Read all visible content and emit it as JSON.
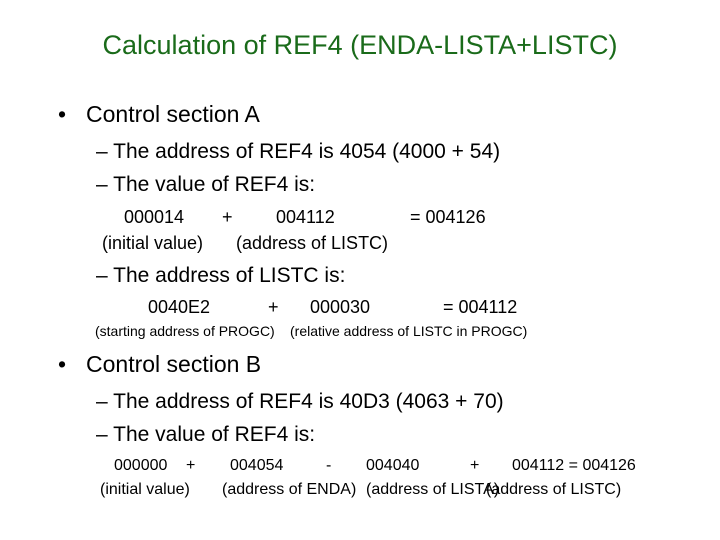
{
  "title": "Calculation of REF4 (ENDA-LISTA+LISTC)",
  "colors": {
    "title": "#1a6b1a",
    "text": "#000000",
    "background": "#ffffff"
  },
  "sections": [
    {
      "heading": "Control section A",
      "items": [
        "The address of REF4 is 4054 (4000 + 54)",
        "The value of REF4 is:"
      ],
      "value_calc": {
        "terms": [
          "000014",
          "+",
          "004112",
          "= 004126"
        ],
        "notes": [
          "(initial value)",
          "(address of LISTC)"
        ]
      },
      "item3": "The address of LISTC is:",
      "address_calc": {
        "terms": [
          "0040E2",
          "+",
          "000030",
          "= 004112"
        ],
        "notes": [
          "(starting address of PROGC)",
          "(relative address of LISTC in PROGC)"
        ]
      }
    },
    {
      "heading": "Control section B",
      "items": [
        "The address of REF4 is 40D3 (4063 + 70)",
        "The value of REF4 is:"
      ],
      "value_calc": {
        "terms": [
          "000000",
          "+",
          "004054",
          "-",
          "004040",
          "+",
          "004112 = 004126"
        ],
        "notes": [
          "(initial value)",
          "(address of ENDA)",
          "(address of LISTA)",
          "(address of LISTC)"
        ]
      }
    }
  ],
  "bullet": "•",
  "dash": "–"
}
